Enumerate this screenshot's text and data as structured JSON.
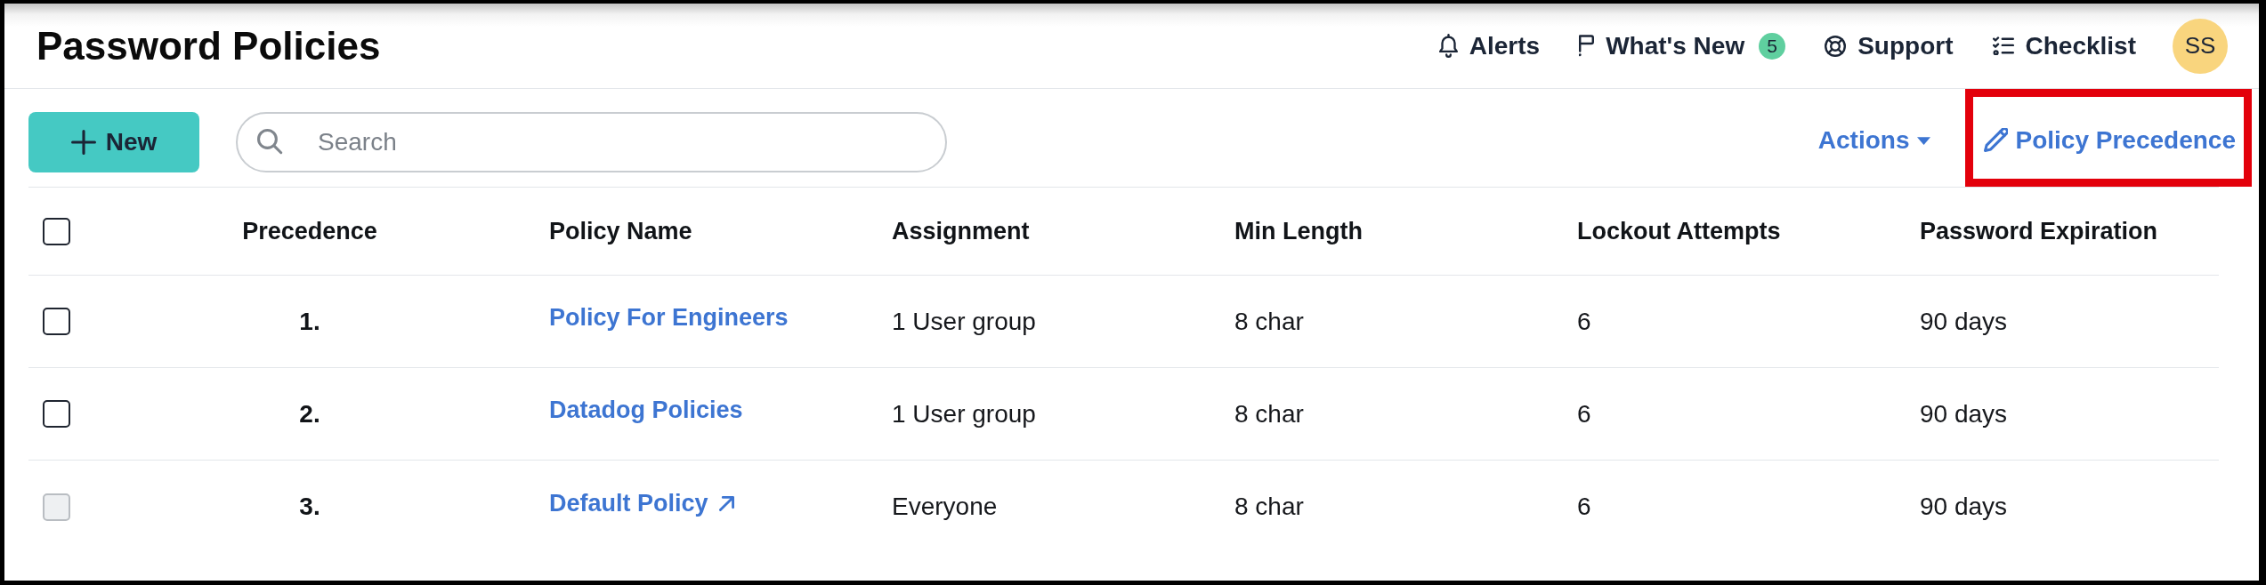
{
  "page": {
    "title": "Password Policies"
  },
  "header_nav": [
    {
      "kind": "alerts",
      "label": "Alerts"
    },
    {
      "kind": "whats_new",
      "label": "What's New",
      "badge": "5"
    },
    {
      "kind": "support",
      "label": "Support"
    },
    {
      "kind": "checklist",
      "label": "Checklist"
    }
  ],
  "user_avatar": {
    "initials": "SS"
  },
  "toolbar": {
    "new_button": {
      "label": "New"
    },
    "search": {
      "placeholder": "Search"
    },
    "actions": [
      {
        "kind": "dropdown",
        "label": "Actions",
        "highlighted": false
      },
      {
        "kind": "edit",
        "label": "Policy Precedence",
        "highlighted": true
      }
    ]
  },
  "table": {
    "select_all": {
      "checked": false
    },
    "columns": [
      "Precedence",
      "Policy Name",
      "Assignment",
      "Min Length",
      "Lockout Attempts",
      "Password Expiration"
    ],
    "rows": [
      {
        "checked": false,
        "disabled": false,
        "precedence": "1.",
        "policy_name": "Policy For Engineers",
        "external_link": false,
        "assignment": "1 User group",
        "min_length": "8 char",
        "lockout_attempts": "6",
        "password_expiration": "90 days"
      },
      {
        "checked": false,
        "disabled": false,
        "precedence": "2.",
        "policy_name": "Datadog Policies",
        "external_link": false,
        "assignment": "1 User group",
        "min_length": "8 char",
        "lockout_attempts": "6",
        "password_expiration": "90 days"
      },
      {
        "checked": false,
        "disabled": true,
        "precedence": "3.",
        "policy_name": "Default Policy",
        "external_link": true,
        "assignment": "Everyone",
        "min_length": "8 char",
        "lockout_attempts": "6",
        "password_expiration": "90 days"
      }
    ]
  }
}
